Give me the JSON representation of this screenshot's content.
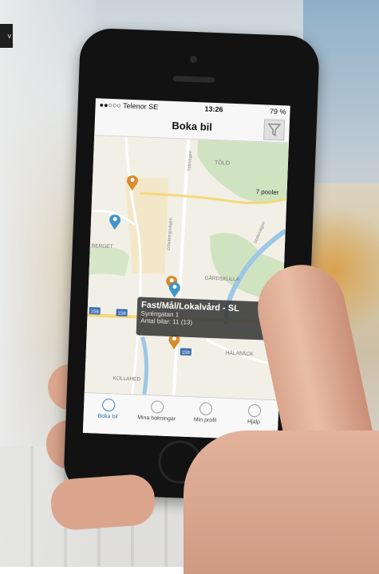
{
  "corner_tag": "v",
  "status_bar": {
    "carrier": "●●○○○ Telenor SE",
    "time": "13:26",
    "battery": "79 %"
  },
  "navbar": {
    "title": "Boka bil"
  },
  "map": {
    "labels": [
      {
        "text": "TÖLÖ"
      },
      {
        "text": "7 pooler"
      },
      {
        "text": "BERGET"
      },
      {
        "text": "GÅRDSKULLA"
      },
      {
        "text": "HÅLABÄCK"
      },
      {
        "text": "KOLLAHED"
      },
      {
        "text": "Göteborgsvägen"
      },
      {
        "text": "Södervägen"
      },
      {
        "text": "Tölövägen"
      },
      {
        "text": "158"
      }
    ],
    "pins": [
      {
        "color": "#d98a2b"
      },
      {
        "color": "#3f96c7"
      },
      {
        "color": "#d98a2b"
      },
      {
        "color": "#3f96c7"
      },
      {
        "color": "#d98a2b"
      }
    ],
    "tooltip": {
      "title": "Fast/Mål/Lokalvård - SL",
      "address": "Syréngatan 1",
      "count": "Antal bilar: 11 (13)"
    }
  },
  "tabs": [
    {
      "label": "Boka bil",
      "active": true
    },
    {
      "label": "Mina bokningar"
    },
    {
      "label": "Min profil"
    },
    {
      "label": "Hjälp"
    }
  ],
  "colors": {
    "accent": "#1f6fb8",
    "park": "#cfe3c1",
    "water": "#9cc7e6"
  }
}
